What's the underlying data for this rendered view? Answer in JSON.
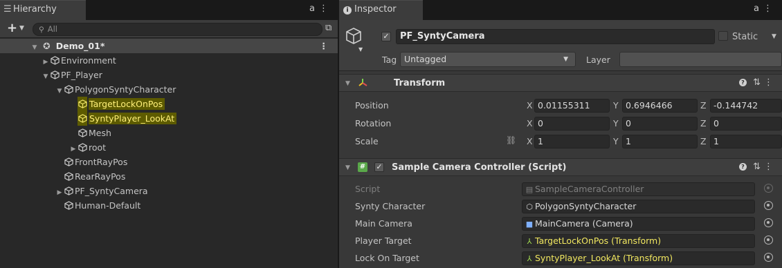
{
  "hierarchy": {
    "tab_label": "Hierarchy",
    "search_placeholder": "All",
    "scene": "Demo_01*",
    "rows": [
      {
        "label": "Environment",
        "depth": 1,
        "arrow": "right"
      },
      {
        "label": "PF_Player",
        "depth": 1,
        "arrow": "down"
      },
      {
        "label": "PolygonSyntyCharacter",
        "depth": 2,
        "arrow": "down"
      },
      {
        "label": "TargetLockOnPos",
        "depth": 3,
        "arrow": "",
        "highlight": true
      },
      {
        "label": "SyntyPlayer_LookAt",
        "depth": 3,
        "arrow": "",
        "highlight": true
      },
      {
        "label": "Mesh",
        "depth": 3,
        "arrow": ""
      },
      {
        "label": "root",
        "depth": 3,
        "arrow": "right"
      },
      {
        "label": "FrontRayPos",
        "depth": 2,
        "arrow": ""
      },
      {
        "label": "RearRayPos",
        "depth": 2,
        "arrow": ""
      },
      {
        "label": "PF_SyntyCamera",
        "depth": 2,
        "arrow": "right"
      },
      {
        "label": "Human-Default",
        "depth": 2,
        "arrow": ""
      }
    ]
  },
  "inspector": {
    "tab_label": "Inspector",
    "object_name": "PF_SyntyCamera",
    "static_label": "Static",
    "tag_label": "Tag",
    "tag_value": "Untagged",
    "layer_label": "Layer",
    "layer_value": "",
    "transform": {
      "title": "Transform",
      "position": {
        "label": "Position",
        "x": "0.01155311",
        "y": "0.6946466",
        "z": "-0.144742"
      },
      "rotation": {
        "label": "Rotation",
        "x": "0",
        "y": "0",
        "z": "0"
      },
      "scale": {
        "label": "Scale",
        "x": "1",
        "y": "1",
        "z": "1"
      },
      "axis_x": "X",
      "axis_y": "Y",
      "axis_z": "Z"
    },
    "script_component": {
      "title": "Sample Camera Controller (Script)",
      "fields": [
        {
          "label": "Script",
          "value": "SampleCameraController",
          "icon": "script-file-icon",
          "dim": true
        },
        {
          "label": "Synty Character",
          "value": "PolygonSyntyCharacter",
          "icon": "gameobject-icon"
        },
        {
          "label": "Main Camera",
          "value": "MainCamera (Camera)",
          "icon": "camera-icon"
        },
        {
          "label": "Player Target",
          "value": "TargetLockOnPos (Transform)",
          "icon": "transform-icon",
          "highlight": true
        },
        {
          "label": "Lock On Target",
          "value": "SyntyPlayer_LookAt (Transform)",
          "icon": "transform-icon",
          "highlight": true
        }
      ]
    }
  },
  "colors": {
    "highlight_bg": "#5d5b00",
    "highlight_text": "#fff07a",
    "script_icon": "#5aa84a",
    "transform_x": "#e05050",
    "transform_y": "#7ad34e",
    "transform_z": "#f0c020"
  }
}
